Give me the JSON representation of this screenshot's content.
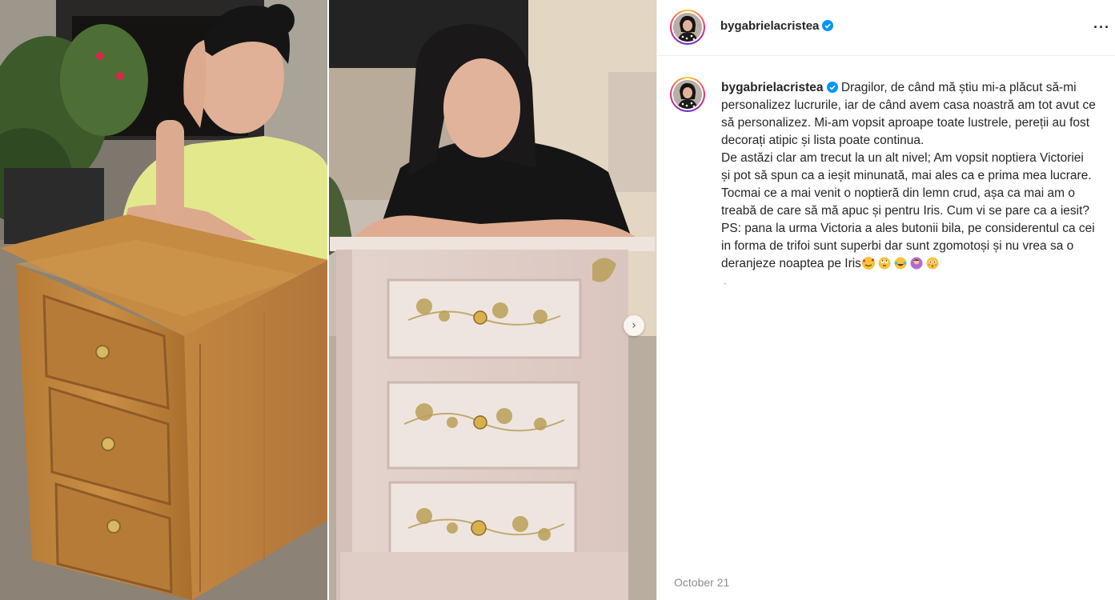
{
  "post": {
    "username": "bygabrielacristea",
    "verified": true,
    "more_icon": "more-horizontal-icon",
    "caption_lines": [
      "Dragilor, de când mă știu mi-a plăcut să-mi",
      "personalizez lucrurile, iar de când avem casa noastră am tot avut ce",
      "să personalizez. Mi-am vopsit aproape toate lustrele, pereții au fost",
      "decorați atipic și lista poate continua.",
      "De astăzi clar am trecut la un alt nivel; Am vopsit noptiera Victoriei",
      "și pot să spun ca a ieșit minunată, mai ales ca e prima mea lucrare.",
      "Tocmai ce a mai venit o noptieră din lemn crud, așa ca mai am o",
      "treabă de care să mă apuc și pentru Iris. Cum vi se pare ca a iesit?",
      "PS: pana la urma Victoria a ales butonii bila, pe considerentul ca cei",
      "in forma de trifoi sunt superbi dar sunt zgomotoși și nu vrea sa o",
      "deranjeze noaptea pe Iris"
    ],
    "caption_emojis": [
      "smiling-face-with-hearts",
      "face-with-rolling-eyes",
      "face-with-tears-of-joy",
      "woman-shrugging",
      "flushed-face"
    ],
    "date": "October 21"
  },
  "media": {
    "next_icon": "chevron-right-icon",
    "next_label": "›"
  },
  "colors": {
    "verified": "#0095f6",
    "text": "#262626",
    "muted": "#8e8e8e",
    "divider": "#efefef"
  }
}
